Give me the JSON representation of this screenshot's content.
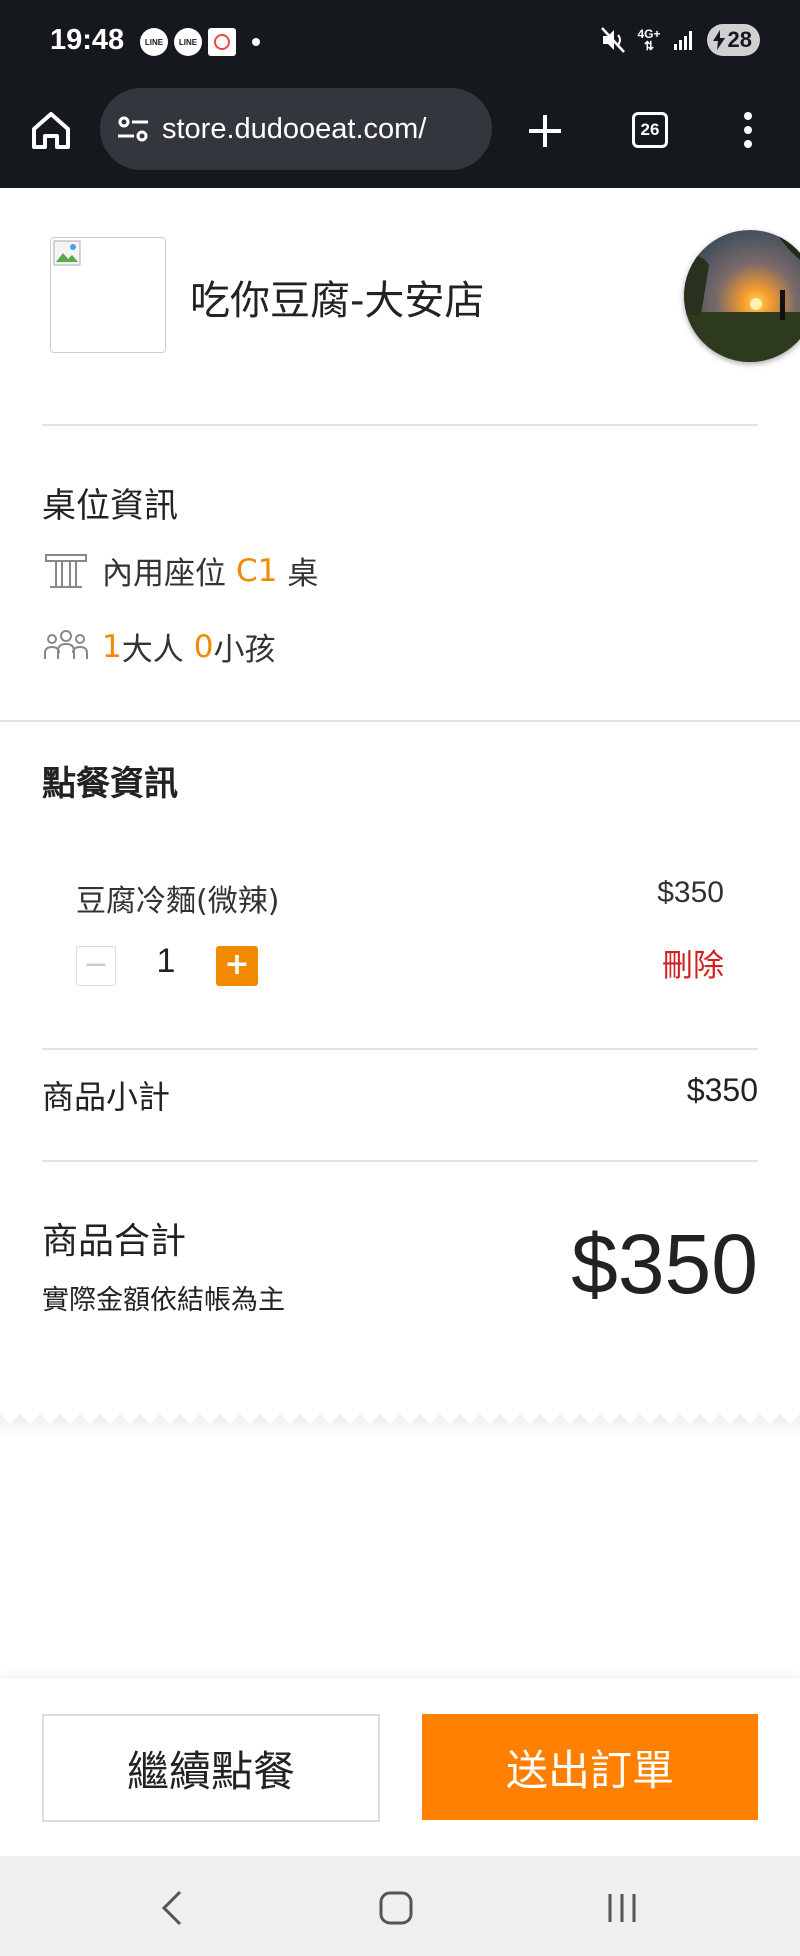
{
  "status_bar": {
    "time": "19:48",
    "notifications": [
      "LINE",
      "LINE"
    ],
    "network": "4G+",
    "battery": "28"
  },
  "browser": {
    "url": "store.dudooeat.com/",
    "tab_count": "26"
  },
  "store": {
    "name": "吃你豆腐-大安店"
  },
  "table_info": {
    "title": "桌位資訊",
    "seat_prefix": "內用座位",
    "seat_code": "C1",
    "seat_suffix": "桌",
    "adults": "1",
    "adults_label": "大人",
    "children": "0",
    "children_label": "小孩"
  },
  "order_info": {
    "title": "點餐資訊",
    "items": [
      {
        "name": "豆腐冷麵(微辣)",
        "price": "$350",
        "quantity": "1",
        "delete_label": "刪除"
      }
    ],
    "subtotal_label": "商品小計",
    "subtotal_value": "$350",
    "total_label": "商品合計",
    "total_note": "實際金額依結帳為主",
    "total_value": "$350"
  },
  "actions": {
    "continue_label": "繼續點餐",
    "submit_label": "送出訂單"
  },
  "colors": {
    "accent": "#ff8000",
    "highlight": "#f28a00",
    "danger": "#d32020"
  },
  "icons": [
    "home-icon",
    "site-settings-icon",
    "plus-icon",
    "tabs-icon",
    "more-vert-icon",
    "table-icon",
    "people-icon",
    "back-icon",
    "home-nav-icon",
    "recents-icon"
  ]
}
